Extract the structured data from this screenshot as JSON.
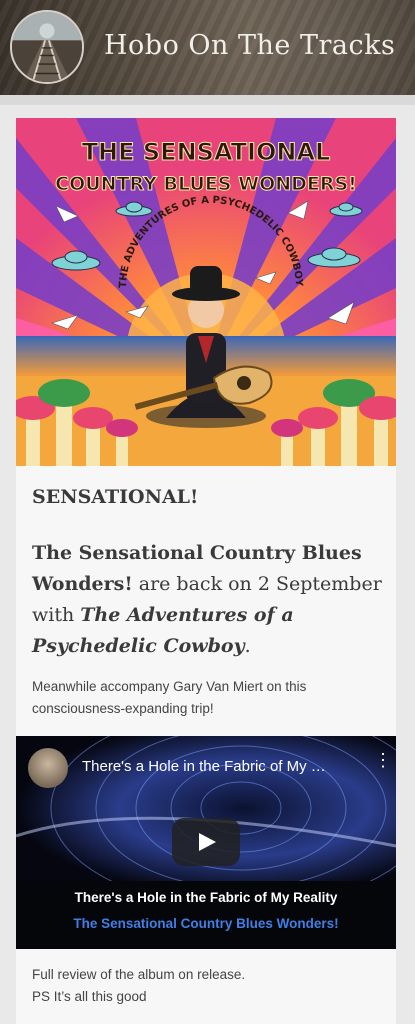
{
  "site": {
    "title": "Hobo On The Tracks",
    "logo_icon": "railroad-tracks-logo"
  },
  "album": {
    "title_line1": "THE SENSATIONAL",
    "title_line2": "COUNTRY BLUES WONDERS!",
    "subtitle": "THE ADVENTURES OF A PSYCHEDELIC COWBOY"
  },
  "post": {
    "heading": "SENSATIONAL!",
    "lead_band": "The Sensational Country Blues Wonders!",
    "lead_mid": " are back on 2 September with ",
    "lead_album": "The Adventures of a Psychedelic Cowboy",
    "lead_end": ".",
    "meanwhile": "Meanwhile accompany Gary Van Miert on this consciousness-expanding trip!",
    "footer_line1": "Full review of the album on release.",
    "footer_line2": "PS It’s all this good"
  },
  "video": {
    "title": "There's a Hole in the Fabric of My Reality",
    "caption_title": "There's a Hole in the Fabric of My Reality",
    "caption_artist": "The Sensational Country Blues Wonders!",
    "menu_icon": "more-vert-icon",
    "play_icon": "play-icon",
    "artist_color": "#3f7fe6"
  },
  "colors": {
    "page_bg": "#e9e9e9",
    "card_bg": "#f7f7f7",
    "text": "#3a3a3a"
  }
}
